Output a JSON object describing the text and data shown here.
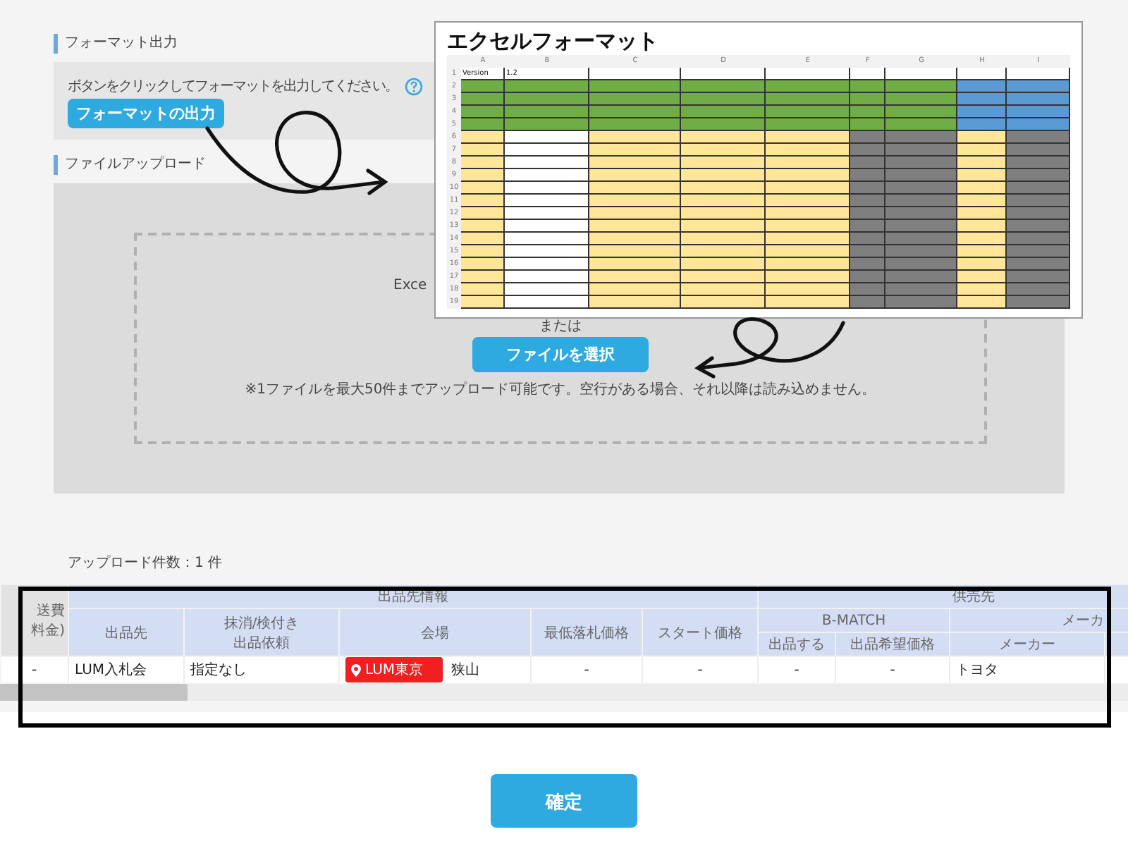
{
  "format_section": {
    "heading": "フォーマット出力",
    "instruction": "ボタンをクリックしてフォーマットを出力してください。",
    "button": "フォーマットの出力"
  },
  "upload_section": {
    "heading": "ファイルアップロード",
    "drop_text": "Exce",
    "or_text": "または",
    "button": "ファイルを選択",
    "note": "※1ファイルを最大50件までアップロード可能です。空行がある場合、それ以降は読み込めません。"
  },
  "upload_count": "アップロード件数：1 件",
  "table": {
    "left_header": [
      "送費",
      "料金)"
    ],
    "groups": [
      {
        "label": "出品先情報"
      },
      {
        "label": "供売先"
      }
    ],
    "subgroups": [
      {
        "label": "B-MATCH"
      },
      {
        "label": "メーカ"
      }
    ],
    "columns": [
      {
        "label": "出品先"
      },
      {
        "label": "抹消/検付き出品依頼"
      },
      {
        "label": "会場"
      },
      {
        "label": "最低落札価格"
      },
      {
        "label": "スタート価格"
      },
      {
        "label": "出品する"
      },
      {
        "label": "出品希望価格"
      },
      {
        "label": "メーカー"
      }
    ],
    "row": {
      "lead": "-",
      "exhibitor": "LUM入札会",
      "request": "指定なし",
      "venue_tag": "LUM東京",
      "venue": "狭山",
      "min_price": "-",
      "start_price": "-",
      "bmatch_list": "-",
      "bmatch_price": "-",
      "maker": "トヨタ"
    }
  },
  "confirm_button": "確定",
  "excel_inset": {
    "title": "エクセルフォーマット",
    "version_label": "Version",
    "version": "1.2",
    "columns": [
      {
        "letter": "A",
        "color": "#ffe699",
        "kind": "listing"
      },
      {
        "letter": "B",
        "color": "#ffffff",
        "kind": "listing"
      },
      {
        "letter": "C",
        "color": "#ffe699",
        "kind": "listing"
      },
      {
        "letter": "D",
        "color": "#ffe699",
        "kind": "listing"
      },
      {
        "letter": "E",
        "color": "#ffe699",
        "kind": "listing"
      },
      {
        "letter": "F",
        "color": "#7f7f7f",
        "kind": "listing"
      },
      {
        "letter": "G",
        "color": "#7f7f7f",
        "kind": "listing"
      },
      {
        "letter": "H",
        "color": "#ffe699",
        "kind": "maker"
      },
      {
        "letter": "I",
        "color": "#7f7f7f",
        "kind": "maker"
      }
    ],
    "row_numbers": [
      "1",
      "2",
      "3",
      "4",
      "5",
      "6",
      "7",
      "8",
      "9",
      "10",
      "11",
      "12",
      "13",
      "14",
      "15",
      "16",
      "17",
      "18",
      "19"
    ]
  }
}
